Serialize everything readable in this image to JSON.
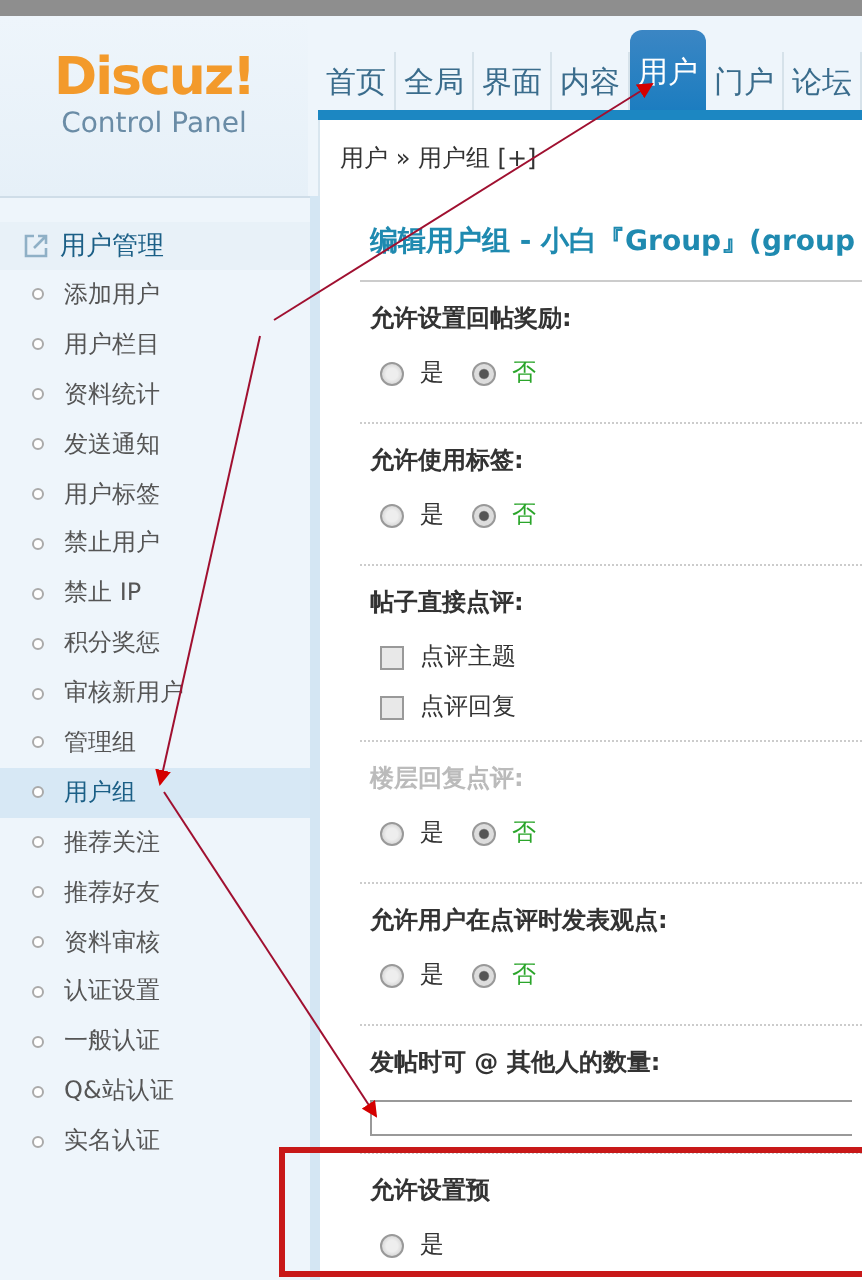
{
  "logo": {
    "title": "Discuz!",
    "subtitle": "Control Panel"
  },
  "nav": [
    {
      "label": "首页",
      "selected": false
    },
    {
      "label": "全局",
      "selected": false
    },
    {
      "label": "界面",
      "selected": false
    },
    {
      "label": "内容",
      "selected": false
    },
    {
      "label": "用户",
      "selected": true
    },
    {
      "label": "门户",
      "selected": false
    },
    {
      "label": "论坛",
      "selected": false
    }
  ],
  "breadcrumb": "用户 » 用户组 [+]",
  "sidebar": {
    "heading": "用户管理",
    "items": [
      {
        "label": "添加用户",
        "selected": false
      },
      {
        "label": "用户栏目",
        "selected": false
      },
      {
        "label": "资料统计",
        "selected": false
      },
      {
        "label": "发送通知",
        "selected": false
      },
      {
        "label": "用户标签",
        "selected": false
      },
      {
        "label": "禁止用户",
        "selected": false
      },
      {
        "label": "禁止 IP",
        "selected": false
      },
      {
        "label": "积分奖惩",
        "selected": false
      },
      {
        "label": "审核新用户",
        "selected": false
      },
      {
        "label": "管理组",
        "selected": false
      },
      {
        "label": "用户组",
        "selected": true
      },
      {
        "label": "推荐关注",
        "selected": false
      },
      {
        "label": "推荐好友",
        "selected": false
      },
      {
        "label": "资料审核",
        "selected": false
      },
      {
        "label": "认证设置",
        "selected": false
      },
      {
        "label": "一般认证",
        "selected": false
      },
      {
        "label": "Q&站认证",
        "selected": false
      },
      {
        "label": "实名认证",
        "selected": false
      }
    ]
  },
  "main": {
    "title": "编辑用户组 - 小白『Group』(group",
    "settings": [
      {
        "kind": "radio",
        "label": "允许设置回帖奖励:",
        "disabled": false,
        "options": [
          {
            "label": "是",
            "selected": false
          },
          {
            "label": "否",
            "selected": true
          }
        ]
      },
      {
        "kind": "radio",
        "label": "允许使用标签:",
        "disabled": false,
        "options": [
          {
            "label": "是",
            "selected": false
          },
          {
            "label": "否",
            "selected": true
          }
        ]
      },
      {
        "kind": "checkbox",
        "label": "帖子直接点评:",
        "disabled": false,
        "options": [
          {
            "label": "点评主题",
            "checked": false
          },
          {
            "label": "点评回复",
            "checked": false
          }
        ]
      },
      {
        "kind": "radio",
        "label": "楼层回复点评:",
        "disabled": true,
        "options": [
          {
            "label": "是",
            "selected": false
          },
          {
            "label": "否",
            "selected": true
          }
        ]
      },
      {
        "kind": "radio",
        "label": "允许用户在点评时发表观点:",
        "disabled": false,
        "options": [
          {
            "label": "是",
            "selected": false
          },
          {
            "label": "否",
            "selected": true
          }
        ]
      },
      {
        "kind": "input",
        "label": "发帖时可 @ 其他人的数量:",
        "disabled": false
      },
      {
        "kind": "radio",
        "label": "允许设置预",
        "disabled": false,
        "options": [
          {
            "label": "是",
            "selected": false
          }
        ]
      }
    ]
  }
}
